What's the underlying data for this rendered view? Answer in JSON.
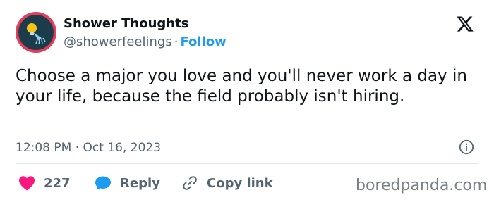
{
  "author": {
    "name": "Shower Thoughts",
    "handle": "@showerfeelings",
    "separator": "·",
    "follow_label": "Follow"
  },
  "tweet": {
    "text": "Choose a major you love and you'll never work a day in your life, because the field probably isn't hiring.",
    "timestamp": "12:08 PM · Oct 16, 2023"
  },
  "actions": {
    "like_count": "227",
    "reply_label": "Reply",
    "copy_label": "Copy link"
  },
  "watermark": "boredpanda.com",
  "colors": {
    "like": "#f91880",
    "reply": "#1d9bf0",
    "follow": "#1d9bf0",
    "avatar_ring": "#e23d5b",
    "avatar_bg": "#1c3c4c"
  },
  "icons": {
    "avatar": "lightbulb-shower-icon",
    "logo": "x-logo-icon",
    "info": "info-icon",
    "like": "heart-icon",
    "reply": "speech-bubble-icon",
    "copy": "link-icon"
  }
}
